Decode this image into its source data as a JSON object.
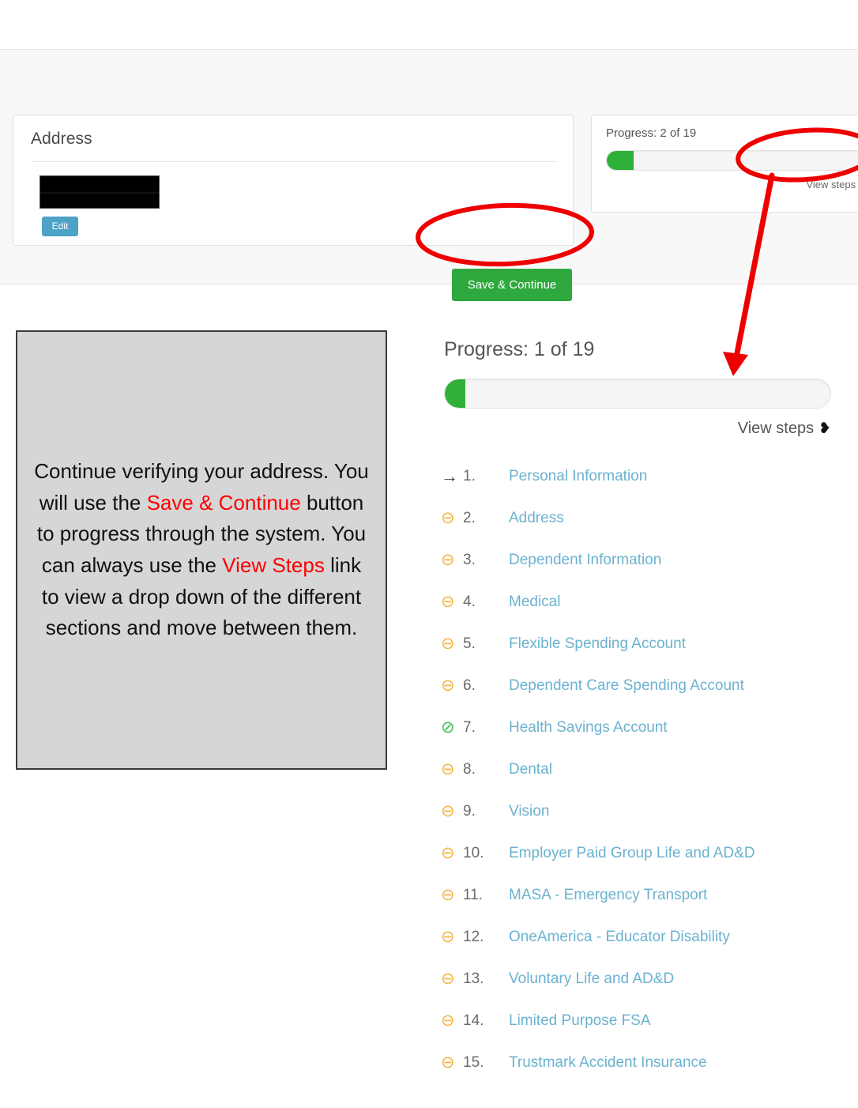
{
  "address_card": {
    "title": "Address",
    "redacted_value": "",
    "edit_label": "Edit"
  },
  "actions": {
    "save_continue_label": "Save & Continue"
  },
  "progress_card_top": {
    "progress_label": "Progress: 2 of 19",
    "current_step": 2,
    "total_steps": 19,
    "percent": 10.5,
    "view_steps_label": "View steps",
    "chevron": "❯"
  },
  "progress_panel": {
    "progress_label": "Progress: 1 of 19",
    "current_step": 1,
    "total_steps": 19,
    "percent": 5.3,
    "view_steps_label": "View steps",
    "chevron": "❥"
  },
  "callout": {
    "part1": "Continue verifying your address. You will use the ",
    "hl1": "Save & Continue",
    "part2": " button to progress through the system. You can always use the ",
    "hl2": "View Steps",
    "part3": " link to view a drop down of the different sections and move between them."
  },
  "steps": [
    {
      "num": "1.",
      "label": "Personal Information",
      "status": "current",
      "icon": "→"
    },
    {
      "num": "2.",
      "label": "Address",
      "status": "pending",
      "icon": "⊖"
    },
    {
      "num": "3.",
      "label": "Dependent Information",
      "status": "pending",
      "icon": "⊖"
    },
    {
      "num": "4.",
      "label": "Medical",
      "status": "pending",
      "icon": "⊖"
    },
    {
      "num": "5.",
      "label": "Flexible Spending Account",
      "status": "pending",
      "icon": "⊖"
    },
    {
      "num": "6.",
      "label": "Dependent Care Spending Account",
      "status": "pending",
      "icon": "⊖"
    },
    {
      "num": "7.",
      "label": "Health Savings Account",
      "status": "done",
      "icon": "⊘"
    },
    {
      "num": "8.",
      "label": "Dental",
      "status": "pending",
      "icon": "⊖"
    },
    {
      "num": "9.",
      "label": "Vision",
      "status": "pending",
      "icon": "⊖"
    },
    {
      "num": "10.",
      "label": "Employer Paid Group Life and AD&D",
      "status": "pending",
      "icon": "⊖"
    },
    {
      "num": "11.",
      "label": "MASA - Emergency Transport",
      "status": "pending",
      "icon": "⊖"
    },
    {
      "num": "12.",
      "label": "OneAmerica - Educator Disability",
      "status": "pending",
      "icon": "⊖"
    },
    {
      "num": "13.",
      "label": "Voluntary Life and AD&D",
      "status": "pending",
      "icon": "⊖"
    },
    {
      "num": "14.",
      "label": "Limited Purpose FSA",
      "status": "pending",
      "icon": "⊖"
    },
    {
      "num": "15.",
      "label": "Trustmark Accident Insurance",
      "status": "pending",
      "icon": "⊖"
    }
  ],
  "colors": {
    "accent_green": "#2fa83e",
    "progress_green": "#2fb039",
    "link_blue": "#6bb2d0",
    "edit_blue": "#4da3c6",
    "pending_orange": "#f5b342",
    "done_green": "#3fc04a",
    "annotation_red": "#ee0000"
  }
}
